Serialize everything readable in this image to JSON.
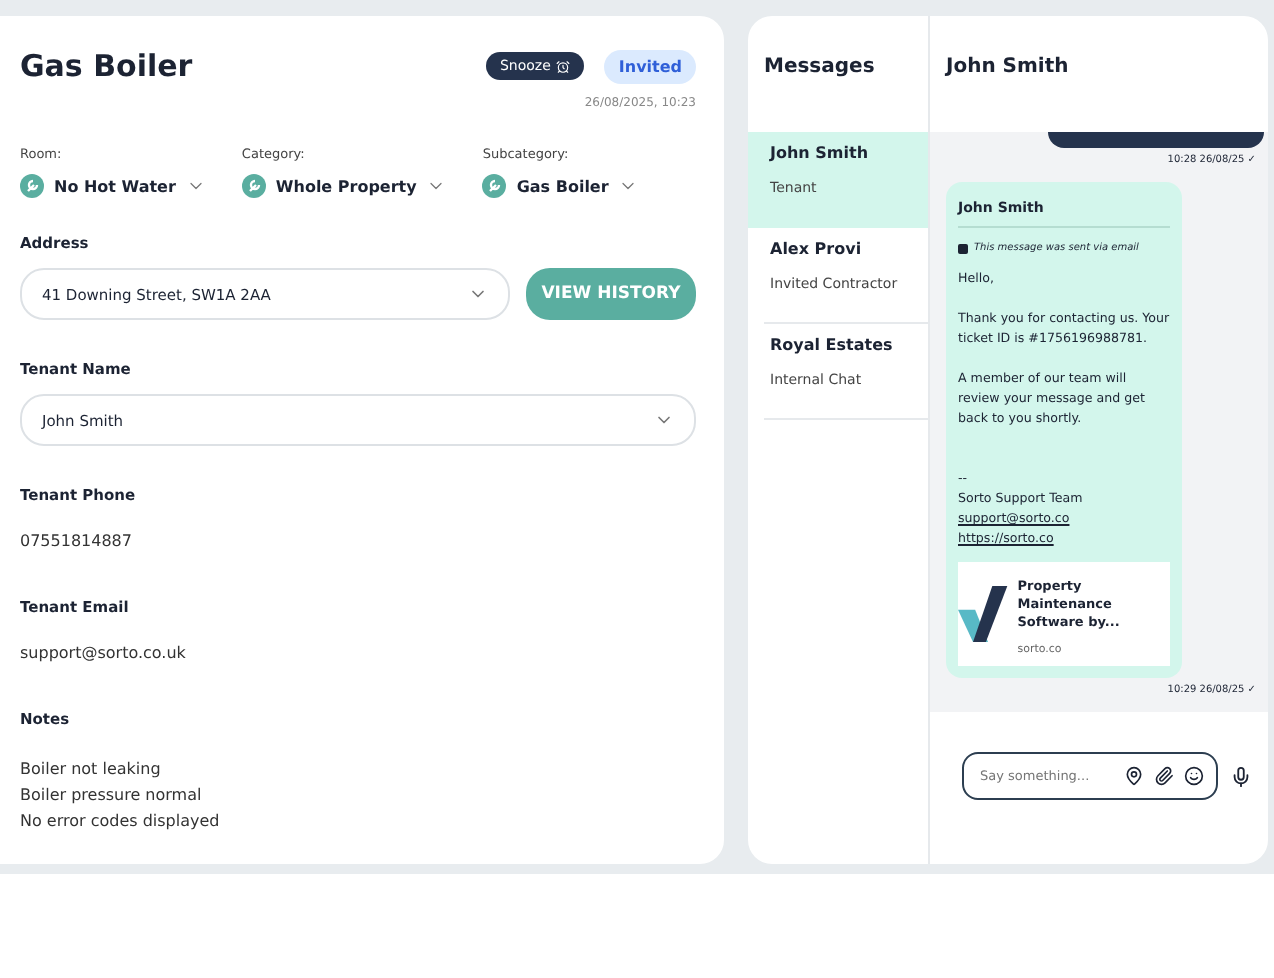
{
  "ticket": {
    "title": "Gas Boiler",
    "snooze": "Snooze",
    "status": "Invited",
    "timestamp": "26/08/2025, 10:23",
    "selectors": [
      {
        "label": "Room:",
        "value": "No Hot Water"
      },
      {
        "label": "Category:",
        "value": "Whole Property"
      },
      {
        "label": "Subcategory:",
        "value": "Gas Boiler"
      }
    ],
    "address": {
      "label": "Address",
      "value": "41 Downing Street, SW1A 2AA",
      "button": "VIEW HISTORY"
    },
    "tenant_name": {
      "label": "Tenant Name",
      "value": "John Smith"
    },
    "tenant_phone": {
      "label": "Tenant Phone",
      "value": "07551814887"
    },
    "tenant_email": {
      "label": "Tenant Email",
      "value": "support@sorto.co.uk"
    },
    "notes": {
      "label": "Notes",
      "lines": [
        "Boiler not leaking",
        "Boiler pressure normal",
        "No error codes displayed"
      ]
    }
  },
  "messages": {
    "title": "Messages",
    "conversations": [
      {
        "name": "John Smith",
        "role": "Tenant",
        "selected": true
      },
      {
        "name": "Alex Provi",
        "role": "Invited Contractor",
        "selected": false
      },
      {
        "name": "Royal Estates",
        "role": "Internal Chat",
        "selected": false
      }
    ]
  },
  "chat": {
    "title": "John Smith",
    "sent_time": "10:28 26/08/25 ✓",
    "message": {
      "sender": "John Smith",
      "email_note": "This message was sent via email",
      "paragraphs": [
        "Hello,",
        "Thank you for contacting us. Your ticket ID is #1756196988781.",
        "A member of our team will review your message and get back to you shortly."
      ],
      "signature": [
        "--",
        "Sorto Support Team"
      ],
      "links": [
        "support@sorto.co",
        "https://sorto.co"
      ],
      "preview": {
        "title": "Property Maintenance Software by...",
        "domain": "sorto.co"
      },
      "time": "10:29 26/08/25 ✓"
    },
    "input_placeholder": "Say something..."
  }
}
